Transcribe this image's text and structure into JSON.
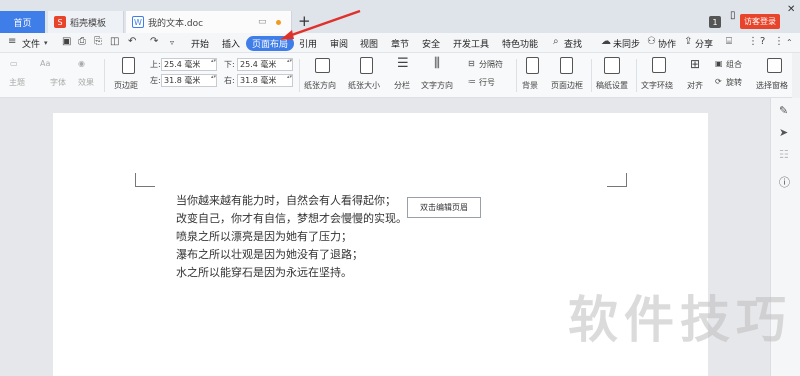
{
  "tabs": {
    "home": "首页",
    "template": "稻壳模板",
    "document": "我的文本.doc",
    "count_badge": "1",
    "visitor_login": "访客登录"
  },
  "menu": {
    "file": "文件",
    "items": [
      "开始",
      "插入",
      "页面布局",
      "引用",
      "审阅",
      "视图",
      "章节",
      "安全",
      "开发工具",
      "特色功能"
    ],
    "search": "查找",
    "sync": "未同步",
    "collab": "协作",
    "share": "分享"
  },
  "ribbon": {
    "theme": "主题",
    "font": "字体",
    "effect": "效果",
    "margins": "页边距",
    "top_label": "上:",
    "top_value": "25.4 毫米",
    "bottom_label": "下:",
    "bottom_value": "25.4 毫米",
    "left_label": "左:",
    "left_value": "31.8 毫米",
    "right_label": "右:",
    "right_value": "31.8 毫米",
    "orientation": "纸张方向",
    "size": "纸张大小",
    "columns": "分栏",
    "text_direction": "文字方向",
    "breaks": "分隔符",
    "line_numbers": "行号",
    "background": "背景",
    "page_border": "页面边框",
    "manuscript": "稿纸设置",
    "wrap": "文字环绕",
    "align": "对齐",
    "group": "组合",
    "rotate": "旋转",
    "selection_pane": "选择窗格"
  },
  "document": {
    "lines": [
      "当你越来越有能力时，自然会有人看得起你；",
      "改变自己，你才有自信，梦想才会慢慢的实现。",
      "喷泉之所以漂亮是因为她有了压力；",
      "瀑布之所以壮观是因为她没有了退路；",
      "水之所以能穿石是因为永远在坚持。"
    ],
    "header_tooltip": "双击编辑页眉"
  },
  "watermark": "软件技巧",
  "colors": {
    "accent": "#3f7ee8",
    "visitor": "#e8432b",
    "arrow": "#e0302a"
  }
}
